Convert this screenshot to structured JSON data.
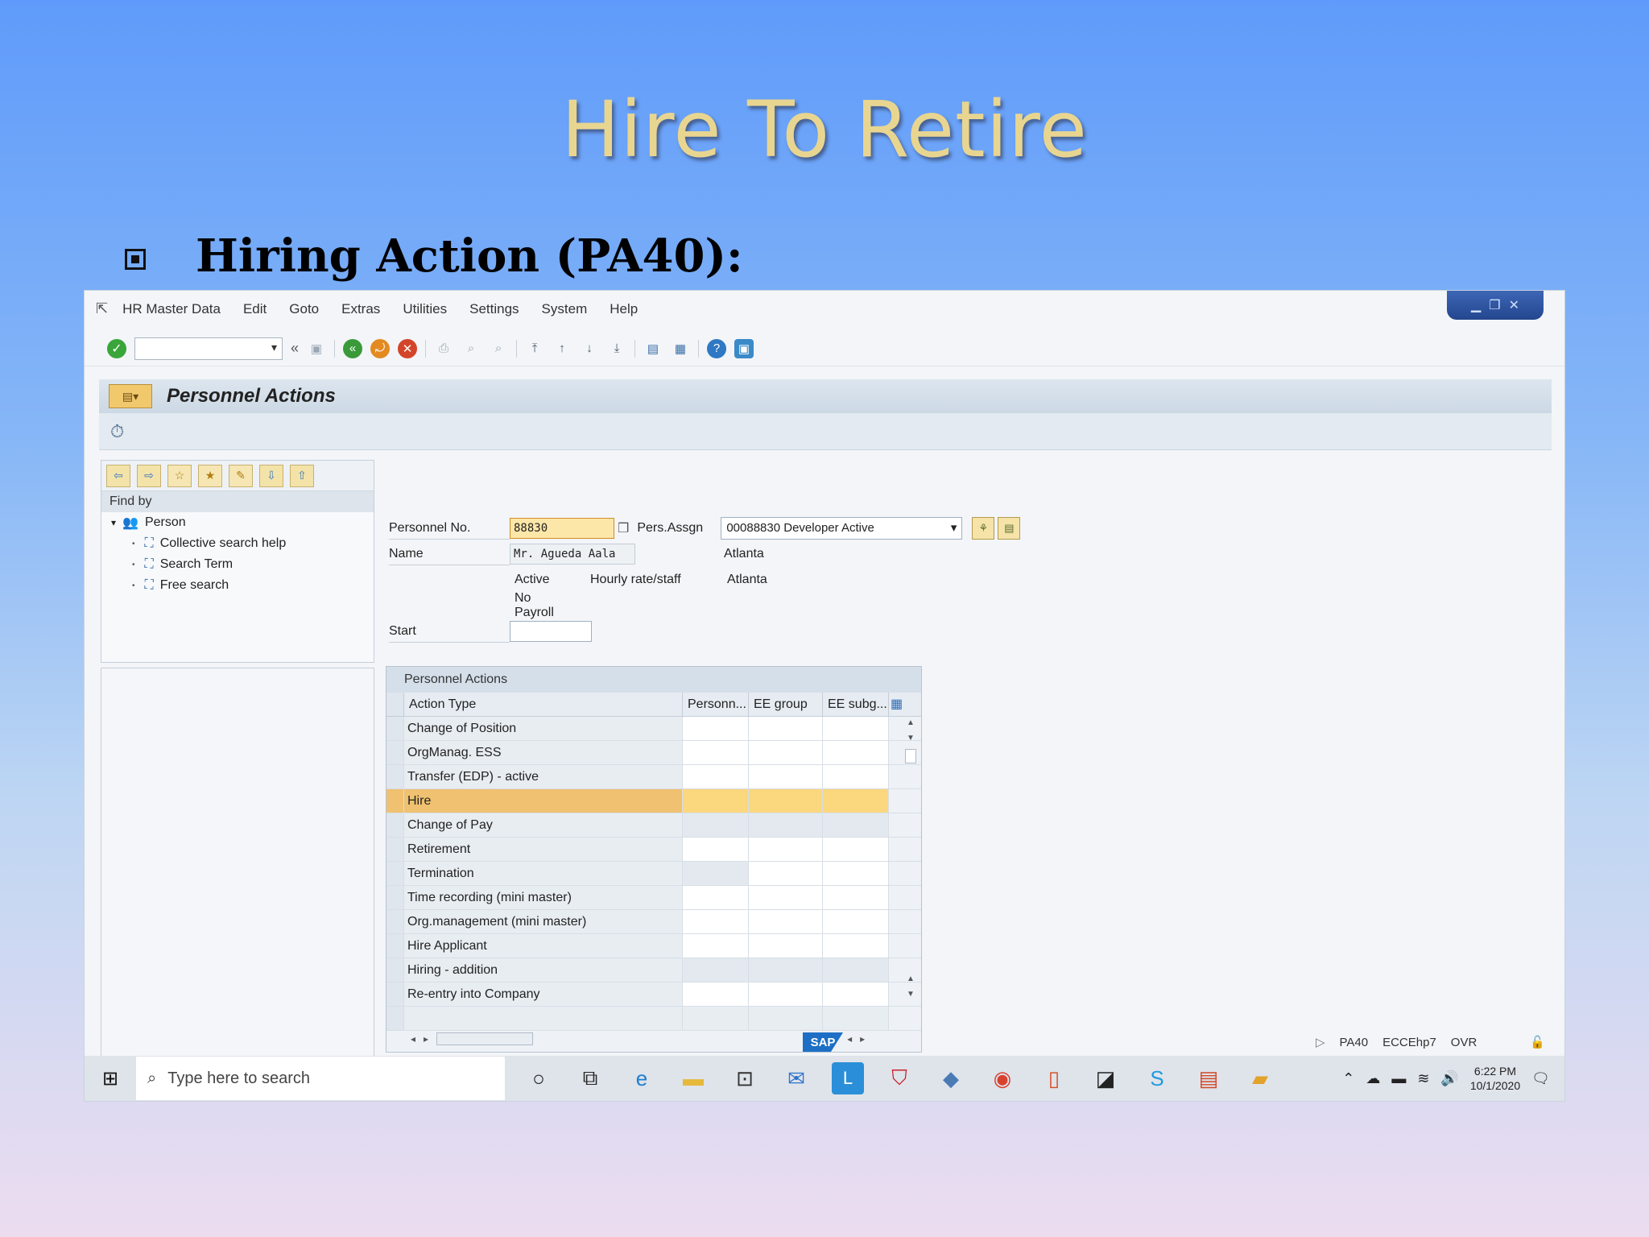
{
  "slide": {
    "title": "Hire To Retire",
    "bullet": "Hiring Action (PA40):"
  },
  "menubar": {
    "items": [
      "HR Master Data",
      "Edit",
      "Goto",
      "Extras",
      "Utilities",
      "Settings",
      "System",
      "Help"
    ]
  },
  "screen": {
    "title": "Personnel Actions"
  },
  "nav": {
    "find_by": "Find by",
    "person": "Person",
    "items": [
      "Collective search help",
      "Search Term",
      "Free search"
    ]
  },
  "form": {
    "pers_no_label": "Personnel No.",
    "pers_no_value": "88830",
    "pers_assign_label": "Pers.Assgn",
    "pers_assign_value": "00088830 Developer Active",
    "name_label": "Name",
    "name_value": "Mr. Agueda Aala",
    "location1": "Atlanta",
    "status": "Active",
    "pay_type": "Hourly rate/staff",
    "location2": "Atlanta",
    "payroll": "No Payroll",
    "start_label": "Start",
    "start_value": ""
  },
  "actions_table": {
    "title": "Personnel Actions",
    "headers": [
      "Action Type",
      "Personn...",
      "EE group",
      "EE subg..."
    ],
    "rows": [
      "Change of Position",
      "OrgManag. ESS",
      "Transfer (EDP) - active",
      "Hire",
      "Change of Pay",
      "Retirement",
      "Termination",
      "Time recording (mini master)",
      "Org.management (mini master)",
      "Hire Applicant",
      "Hiring - addition",
      "Re-entry into Company"
    ],
    "selected": "Hire"
  },
  "status": {
    "transaction": "PA40",
    "system": "ECCEhp7",
    "mode": "OVR",
    "logo": "SAP"
  },
  "taskbar": {
    "search_placeholder": "Type here to search",
    "time": "6:22 PM",
    "date": "10/1/2020"
  }
}
